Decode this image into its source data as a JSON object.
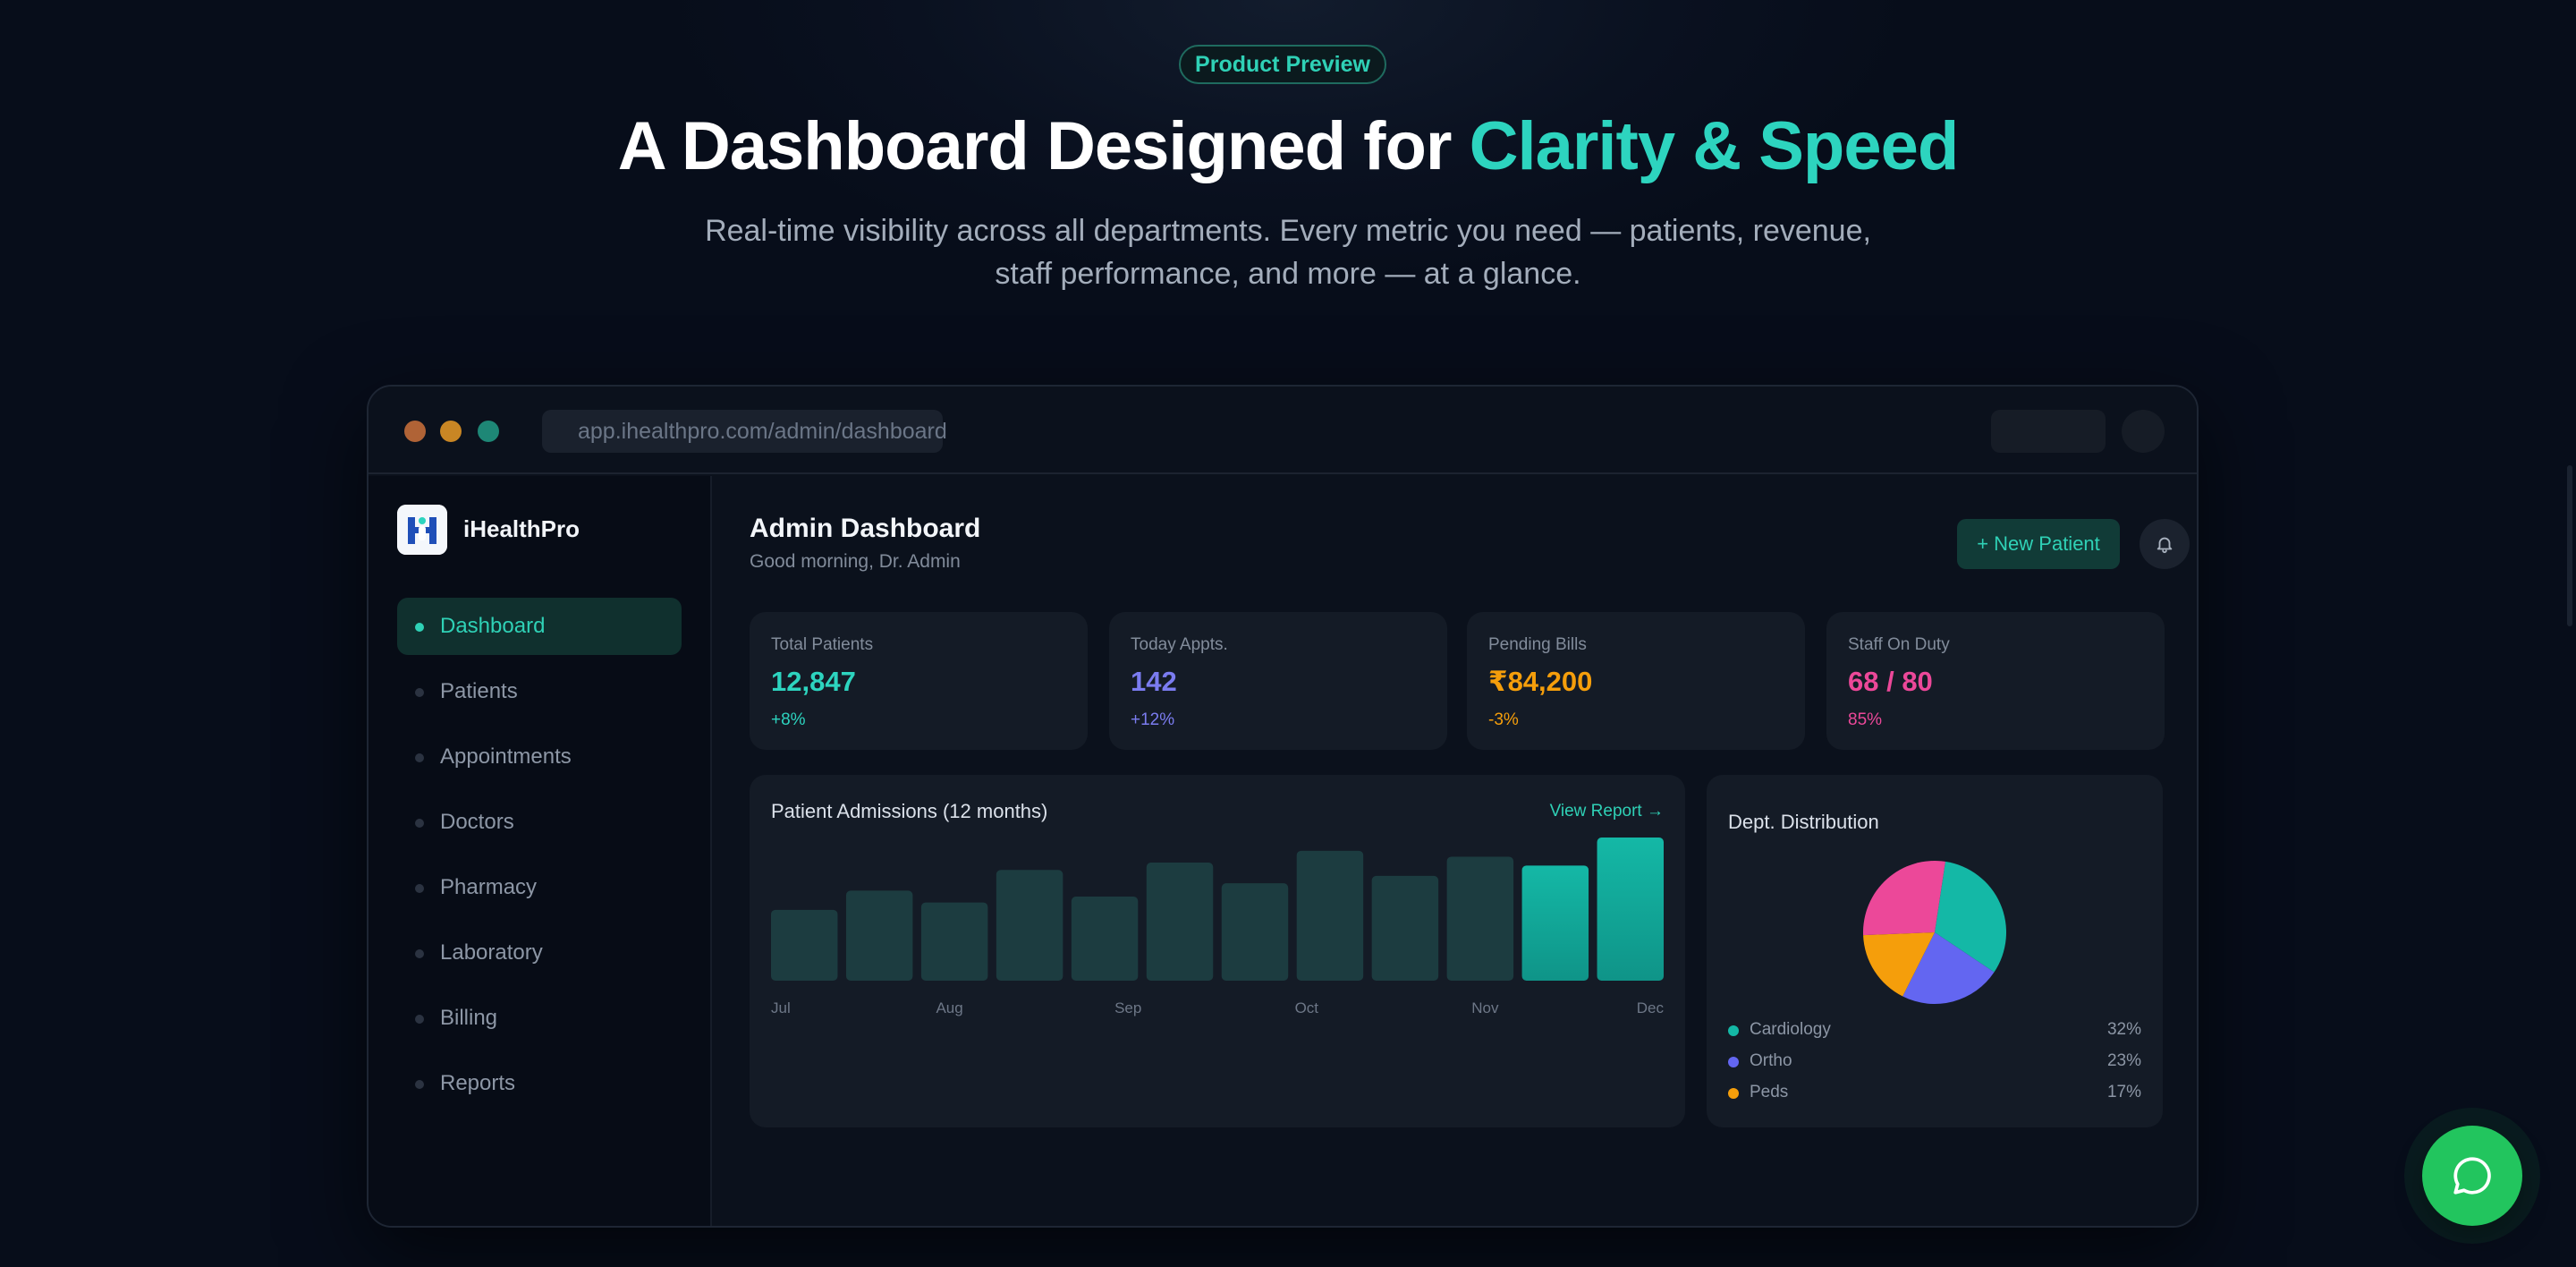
{
  "hero": {
    "eyebrow": "Product Preview",
    "headline_main": "A Dashboard Designed for ",
    "headline_accent": "Clarity & Speed",
    "subtitle_line1": "Real-time visibility across all departments. Every metric you need — patients, revenue,",
    "subtitle_line2": "staff performance, and more — at a glance."
  },
  "browser": {
    "url": "app.ihealthpro.com/admin/dashboard"
  },
  "sidebar": {
    "brand": "iHealthPro",
    "items": [
      {
        "label": "Dashboard",
        "active": true
      },
      {
        "label": "Patients"
      },
      {
        "label": "Appointments"
      },
      {
        "label": "Doctors"
      },
      {
        "label": "Pharmacy"
      },
      {
        "label": "Laboratory"
      },
      {
        "label": "Billing"
      },
      {
        "label": "Reports"
      }
    ]
  },
  "header": {
    "title": "Admin Dashboard",
    "greeting": "Good morning, Dr. Admin",
    "new_patient_label": "+ New Patient"
  },
  "stats": [
    {
      "label": "Total Patients",
      "value": "12,847",
      "change": "+8%",
      "color": "#2dd4bf"
    },
    {
      "label": "Today Appts.",
      "value": "142",
      "change": "+12%",
      "color": "#7b7cf0"
    },
    {
      "label": "Pending Bills",
      "value": "₹84,200",
      "change": "-3%",
      "color": "#f59e0b"
    },
    {
      "label": "Staff On Duty",
      "value": "68 / 80",
      "change": "85%",
      "color": "#ec4899"
    }
  ],
  "chart_data": [
    {
      "type": "bar",
      "title": "Patient Admissions (12 months)",
      "link_label": "View Report →",
      "tick_labels": [
        "Jul",
        "Aug",
        "Sep",
        "Oct",
        "Nov",
        "Dec"
      ],
      "values": [
        48,
        61,
        53,
        75,
        57,
        80,
        66,
        88,
        71,
        84,
        78,
        97
      ],
      "highlight_last": 2,
      "colors": {
        "bar": "#1c3c40",
        "highlight_top": "#14b8a6",
        "highlight_bottom": "#0f9488"
      }
    },
    {
      "type": "pie",
      "title": "Dept. Distribution",
      "slices": [
        {
          "name": "Cardiology",
          "value": 32,
          "label": "32%",
          "color": "#14b8a6"
        },
        {
          "name": "Ortho",
          "value": 23,
          "label": "23%",
          "color": "#6366f1"
        },
        {
          "name": "Peds",
          "value": 17,
          "label": "17%",
          "color": "#f59e0b"
        },
        {
          "name": "",
          "value": 28,
          "color": "#ec4899"
        }
      ]
    }
  ]
}
